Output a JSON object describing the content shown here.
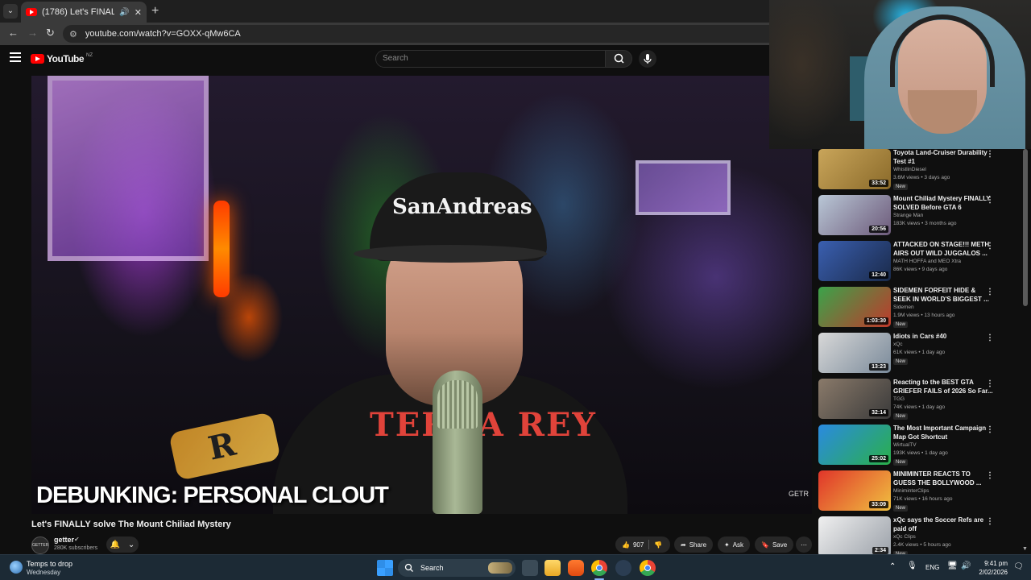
{
  "browser": {
    "tab": {
      "title": "(1786) Let's FINALLY solve T",
      "speaker_icon": "speaker-icon",
      "close_label": "✕"
    },
    "new_tab_label": "+",
    "url": "youtube.com/watch?v=GOXX-qMw6CA"
  },
  "youtube": {
    "logo_text": "YouTube",
    "country_code": "NZ",
    "search_placeholder": "Search"
  },
  "video": {
    "caption": "DEBUNKING: PERSONAL CLOUT",
    "cap_text": "SanAndreas",
    "shirt_text": "TERRA REY",
    "sign_letter": "R",
    "watermark": "GETR"
  },
  "below_video": {
    "title": "Let's FINALLY solve The Mount Chiliad Mystery",
    "channel_name": "getter",
    "avatar_text": "GETTER",
    "subscribers": "280K subscribers",
    "likes": "907",
    "share_label": "Share",
    "ask_label": "Ask",
    "save_label": "Save"
  },
  "recommendations": [
    {
      "title": "Toyota Land-Cruiser Durability Test #1",
      "channel": "WhistlinDiesel",
      "meta": "3.6M views • 3 days ago",
      "duration": "33:52",
      "new": "New",
      "thumb": [
        "#c9a55a",
        "#8a6a2a"
      ]
    },
    {
      "title": "Mount Chiliad Mystery FINALLY SOLVED Before GTA 6",
      "channel": "Strange Man",
      "meta": "183K views • 3 months ago",
      "duration": "20:56",
      "new": "",
      "thumb": [
        "#b9c7d6",
        "#6d5a7a"
      ]
    },
    {
      "title": "ATTACKED ON STAGE!!! METH AIRS OUT WILD JUGGALOS ...",
      "channel": "MATH HOFFA  and MEO Xtra",
      "meta": "86K views • 9 days ago",
      "duration": "12:40",
      "new": "",
      "thumb": [
        "#3a5fb0",
        "#1a2a4a"
      ]
    },
    {
      "title": "SIDEMEN FORFEIT HIDE & SEEK IN WORLD'S BIGGEST ...",
      "channel": "Sidemen",
      "meta": "1.9M views • 13 hours ago",
      "duration": "1:03:30",
      "new": "New",
      "thumb": [
        "#3aa34a",
        "#c0392b"
      ]
    },
    {
      "title": "Idiots in Cars #40",
      "channel": "xQc",
      "meta": "61K views • 1 day ago",
      "duration": "13:23",
      "new": "New",
      "thumb": [
        "#d8d8d8",
        "#7a8a9a"
      ]
    },
    {
      "title": "Reacting to the BEST GTA GRIEFER FAILS of 2026 So Far...",
      "channel": "TGG",
      "meta": "74K views • 1 day ago",
      "duration": "32:14",
      "new": "New",
      "thumb": [
        "#8a7a6a",
        "#3a3a3a"
      ]
    },
    {
      "title": "The Most Important Campaign Map Got Shortcut",
      "channel": "WirtualTV",
      "meta": "193K views • 1 day ago",
      "duration": "25:02",
      "new": "New",
      "thumb": [
        "#2a8ae0",
        "#2ab04a"
      ]
    },
    {
      "title": "MINIMINTER REACTS TO GUESS THE BOLLYWOOD ...",
      "channel": "MiniminterClips",
      "meta": "71K views • 16 hours ago",
      "duration": "33:09",
      "new": "New",
      "thumb": [
        "#e0352a",
        "#f0c040"
      ]
    },
    {
      "title": "xQc says the Soccer Refs are paid off",
      "channel": "xQc Clips",
      "meta": "2.4K views • 5 hours ago",
      "duration": "2:34",
      "new": "New",
      "thumb": [
        "#f0f0f0",
        "#9aa0a8"
      ]
    }
  ],
  "taskbar": {
    "weather_title": "Temps to drop",
    "weather_sub": "Wednesday",
    "search_label": "Search",
    "language": "ENG",
    "time": "9:41 pm",
    "date": "2/02/2026"
  },
  "colors": {
    "accent": "#ff0000",
    "background": "#0f0f0f",
    "taskbar": "#1c2a35"
  }
}
